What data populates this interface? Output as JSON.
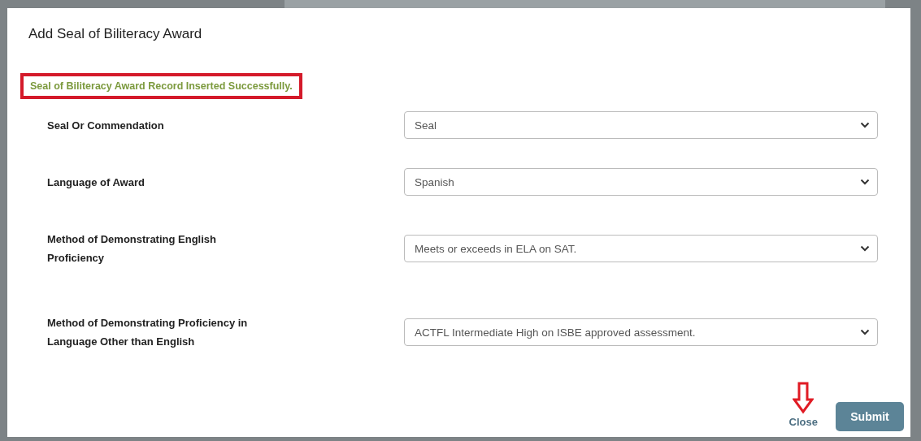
{
  "dialog": {
    "title": "Add Seal of Biliteracy Award",
    "message": {
      "text": "Seal of Biliteracy Award Record Inserted Successfully.",
      "highlighted": true
    },
    "fields": [
      {
        "label": "Seal Or Commendation",
        "value": "Seal"
      },
      {
        "label": "Language of Award",
        "value": "Spanish"
      },
      {
        "label": "Method of Demonstrating English Proficiency",
        "value": "Meets or exceeds in ELA on SAT."
      },
      {
        "label": "Method of Demonstrating Proficiency in Language Other than English",
        "value": "ACTFL Intermediate High on ISBE approved assessment."
      }
    ],
    "buttons": [
      {
        "label": "Close",
        "kind": "link",
        "pointed": true
      },
      {
        "label": "Submit",
        "kind": "primary"
      }
    ]
  }
}
